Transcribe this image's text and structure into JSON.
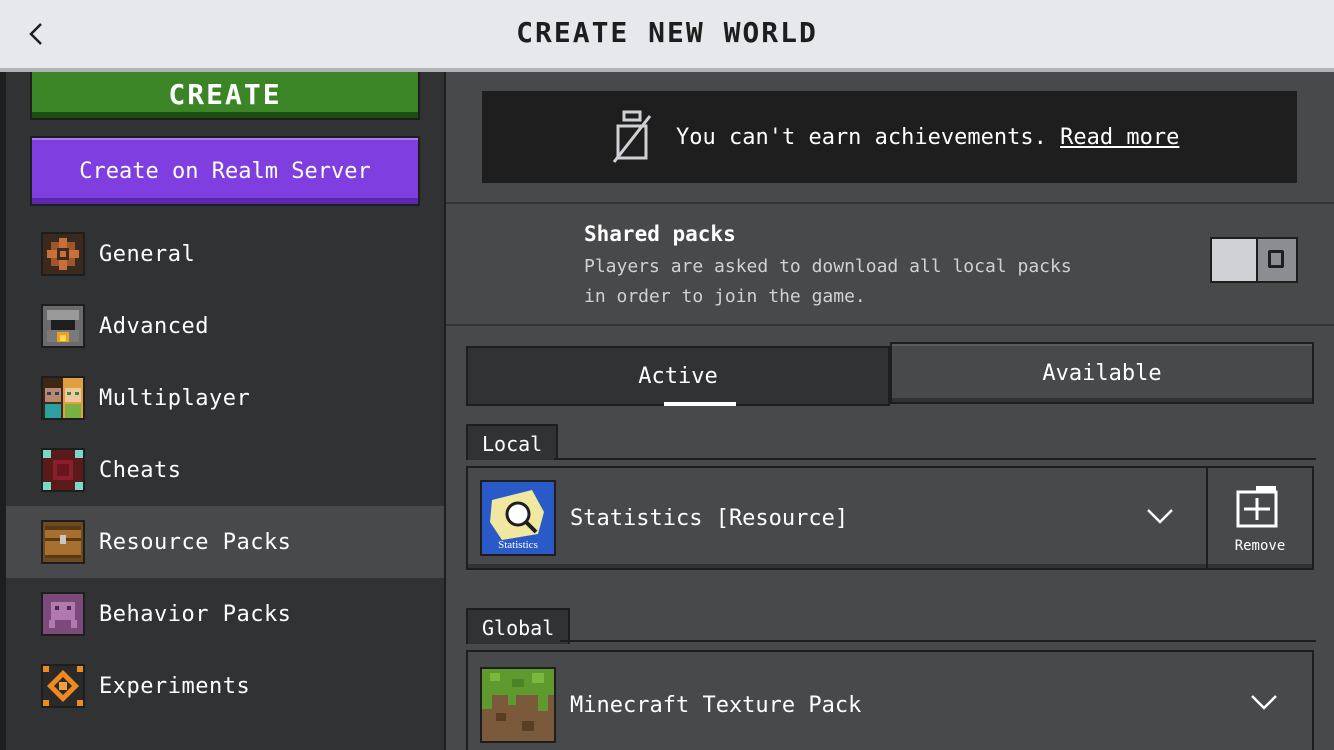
{
  "header": {
    "title": "CREATE NEW WORLD",
    "back_icon": "chevron-left-icon"
  },
  "left": {
    "create_label": "CREATE",
    "realm_label": "Create on Realm Server",
    "nav": [
      {
        "label": "General",
        "icon": "gear-icon"
      },
      {
        "label": "Advanced",
        "icon": "furnace-icon"
      },
      {
        "label": "Multiplayer",
        "icon": "players-icon"
      },
      {
        "label": "Cheats",
        "icon": "command-block-icon"
      },
      {
        "label": "Resource Packs",
        "icon": "chest-icon",
        "selected": true
      },
      {
        "label": "Behavior Packs",
        "icon": "behavior-icon"
      },
      {
        "label": "Experiments",
        "icon": "experiments-icon"
      }
    ]
  },
  "warning": {
    "text": "You can't earn achievements. ",
    "link": "Read more"
  },
  "shared_packs": {
    "title": "Shared packs",
    "desc_line1": "Players are asked to download all local packs",
    "desc_line2": "in order to join the game.",
    "enabled": false
  },
  "tabs": {
    "active": "Active",
    "available": "Available"
  },
  "local": {
    "label": "Local",
    "pack": {
      "name": "Statistics [Resource]",
      "icon_text": "Statistics",
      "remove_label": "Remove"
    }
  },
  "global": {
    "label": "Global",
    "pack": {
      "name": "Minecraft Texture Pack"
    }
  },
  "colors": {
    "create_green": "#3c8527",
    "realm_purple": "#7f3fe0",
    "panel_dark": "#313233",
    "panel": "#48494a"
  }
}
